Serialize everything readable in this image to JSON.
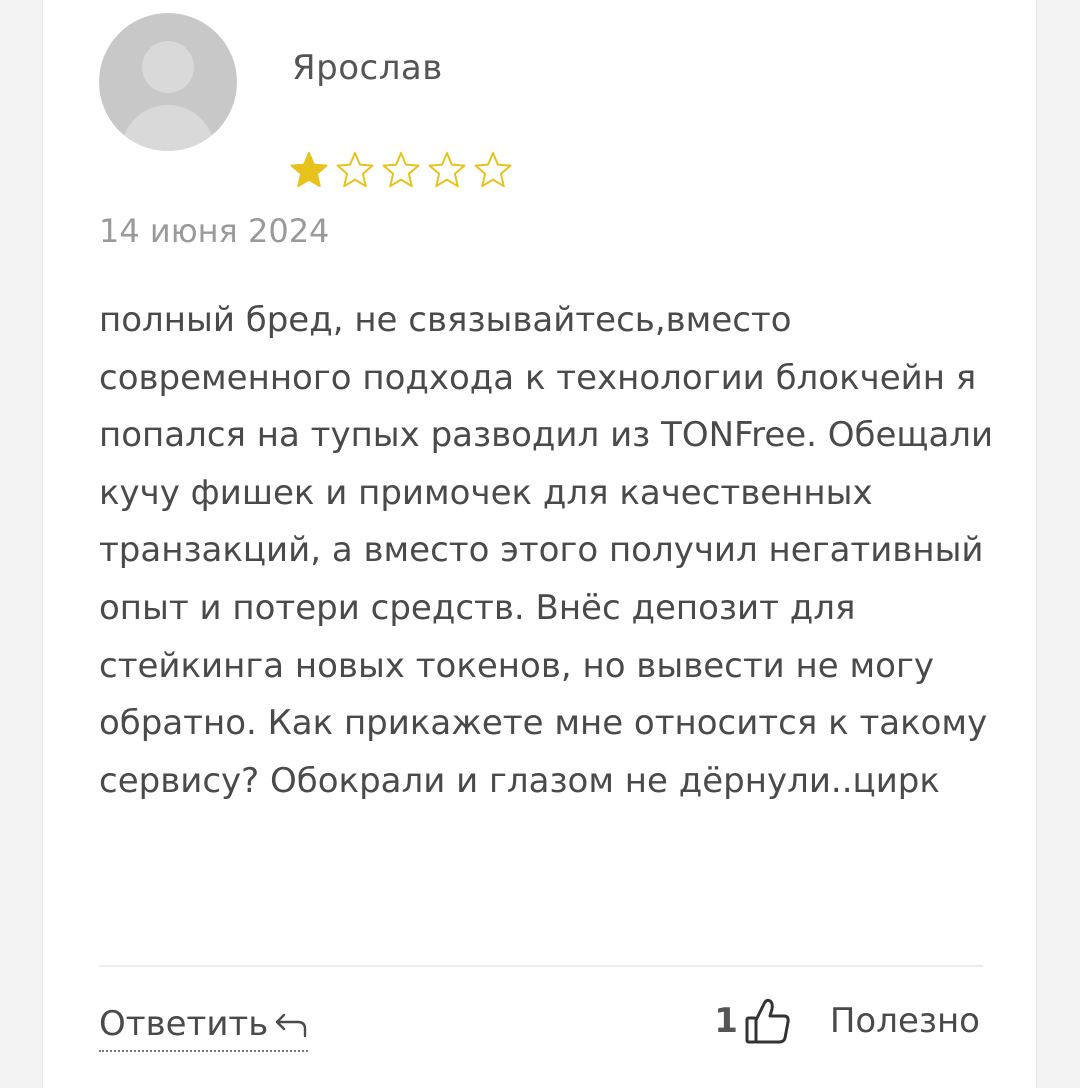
{
  "review": {
    "author": "Ярослав",
    "rating": 1,
    "rating_max": 5,
    "date": "14 июня 2024",
    "text": "полный бред, не связывайтесь,вместо современного подхода к технологии блокчейн я попался на тупых разводил из TONFree. Обещали кучу фишек и примочек для качественных транзакций, а вместо этого получил негативный опыт и потери средств. Внёс депозит для стейкинга новых токенов, но вывести не могу обратно. Как прикажете мне относится к такому сервису? Обокрали и глазом не дёрнули..цирк"
  },
  "actions": {
    "reply_label": "Ответить",
    "helpful_count": "1",
    "helpful_label": "Полезно"
  },
  "icons": {
    "avatar": "user-placeholder-icon",
    "star_filled": "star-filled-icon",
    "star_empty": "star-empty-icon",
    "reply": "reply-arrow-icon",
    "thumb": "thumbs-up-icon"
  },
  "colors": {
    "star": "#e8c21c",
    "text": "#4a4a4a",
    "muted": "#9a9a9a"
  }
}
